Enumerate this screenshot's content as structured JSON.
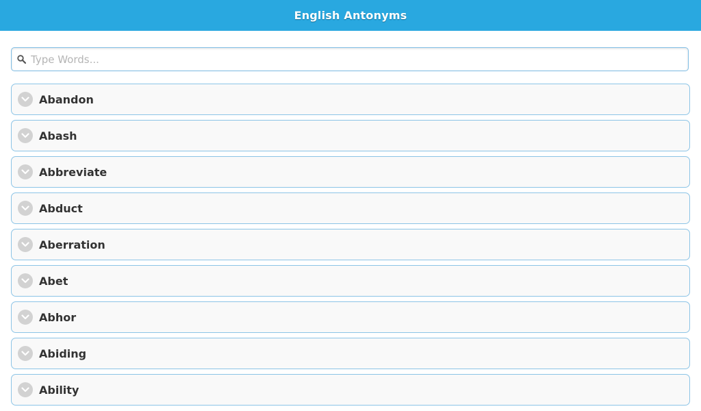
{
  "header": {
    "title": "English Antonyms"
  },
  "search": {
    "placeholder": "Type Words...",
    "value": "",
    "icon": "search-icon"
  },
  "words": {
    "icon": "chevron-down-icon",
    "items": [
      {
        "label": "Abandon"
      },
      {
        "label": "Abash"
      },
      {
        "label": "Abbreviate"
      },
      {
        "label": "Abduct"
      },
      {
        "label": "Aberration"
      },
      {
        "label": "Abet"
      },
      {
        "label": "Abhor"
      },
      {
        "label": "Abiding"
      },
      {
        "label": "Ability"
      }
    ]
  },
  "colors": {
    "header_bg": "#29a8e0",
    "item_border": "#8cc4e6",
    "item_bg": "#f9f9f9",
    "chevron_bg": "#d2d2d2"
  }
}
